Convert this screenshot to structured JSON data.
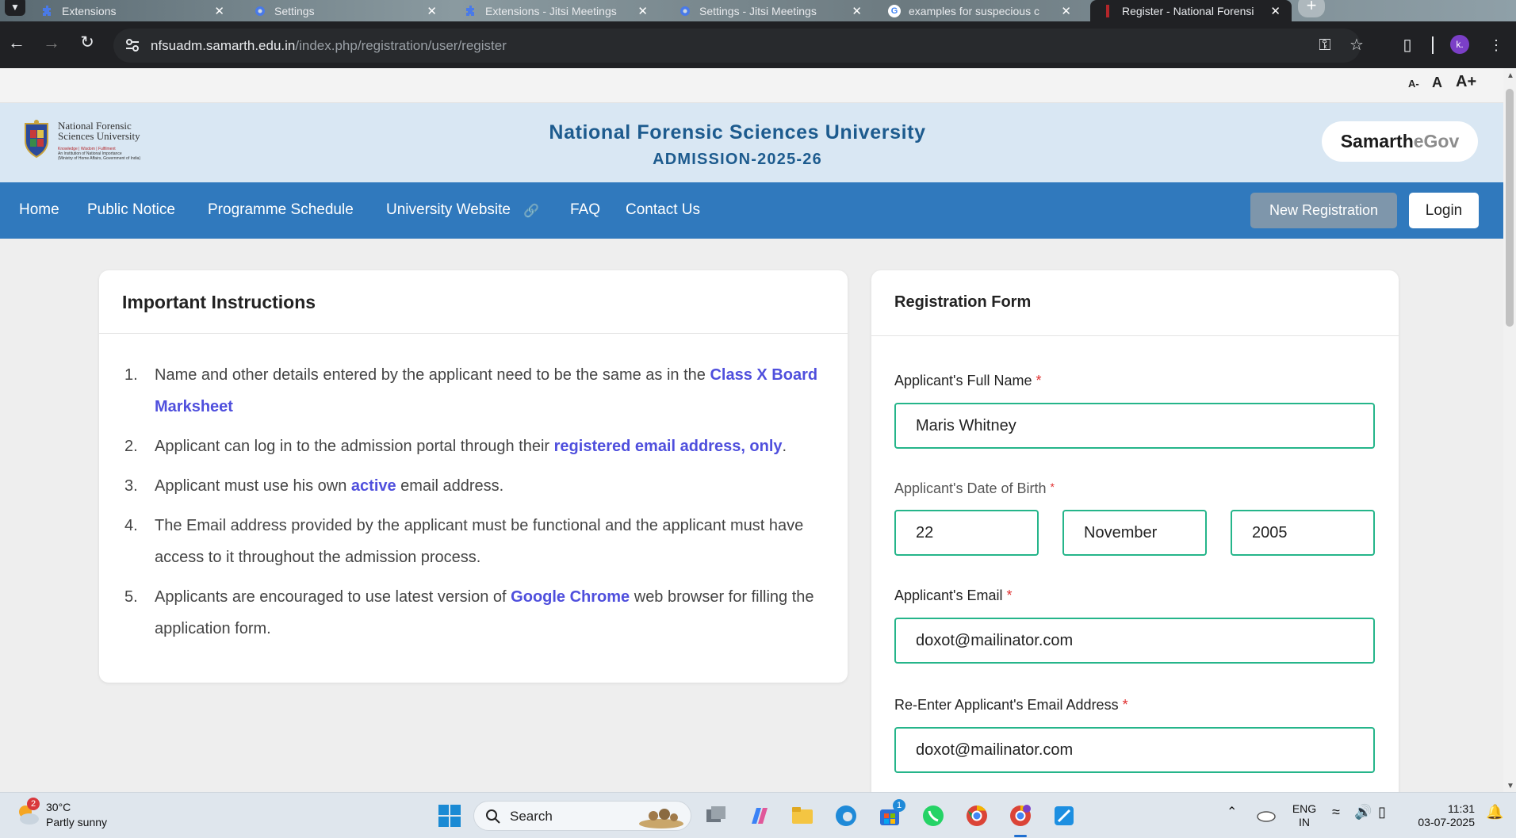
{
  "browser": {
    "tabs": [
      {
        "title": "Extensions",
        "icon": "puzzle-icon"
      },
      {
        "title": "Settings",
        "icon": "gear-icon"
      },
      {
        "title": "Extensions - Jitsi Meetings",
        "icon": "puzzle-icon"
      },
      {
        "title": "Settings - Jitsi Meetings",
        "icon": "gear-icon"
      },
      {
        "title": "examples for suspecious c",
        "icon": "google-icon"
      },
      {
        "title": "Register - National Forensi",
        "icon": "site-icon"
      }
    ],
    "url_host": "nfsuadm.samarth.edu.in",
    "url_path": "/index.php/registration/user/register",
    "profile_initial": "k."
  },
  "font_controls": [
    "A-",
    "A",
    "A+"
  ],
  "header": {
    "logo_line1": "National Forensic",
    "logo_line2": "Sciences University",
    "logo_tagline": "Knowledge | Wisdom | Fulfilment",
    "logo_sub1": "An Institution of National Importance",
    "logo_sub2": "(Ministry of Home Affairs, Government of India)",
    "university": "National Forensic Sciences University",
    "admission": "ADMISSION-2025-26",
    "egov_a": "Samarth",
    "egov_b": "eGov"
  },
  "nav": {
    "items": [
      "Home",
      "Public Notice",
      "Programme Schedule",
      "University Website",
      "FAQ",
      "Contact Us"
    ],
    "new_registration": "New Registration",
    "login": "Login"
  },
  "instructions": {
    "title": "Important Instructions",
    "items": [
      {
        "n": "1.",
        "a": "Name and other details entered by the applicant need to be the same as in the ",
        "b": "Class X Board Marksheet",
        "c": ""
      },
      {
        "n": "2.",
        "a": "Applicant can log in to the admission portal through their ",
        "b": "registered email address, only",
        "c": "."
      },
      {
        "n": "3.",
        "a": "Applicant must use his own ",
        "b": "active",
        "c": " email address."
      },
      {
        "n": "4.",
        "a": "The Email address provided by the applicant must be functional and the applicant must have access to it throughout the admission process.",
        "b": "",
        "c": ""
      },
      {
        "n": "5.",
        "a": "Applicants are encouraged to use latest version of ",
        "b": "Google Chrome",
        "c": " web browser for filling the application form."
      }
    ]
  },
  "form": {
    "title": "Registration Form",
    "name_label": "Applicant's Full Name",
    "name_value": "Maris Whitney",
    "dob_label": "Applicant's Date of Birth",
    "dob_day": "22",
    "dob_month": "November",
    "dob_year": "2005",
    "email_label": "Applicant's Email",
    "email_value": "doxot@mailinator.com",
    "reemail_label": "Re-Enter Applicant's Email Address",
    "reemail_value": "doxot@mailinator.com",
    "required_mark": "*"
  },
  "taskbar": {
    "weather_badge": "2",
    "temp": "30°C",
    "condition": "Partly sunny",
    "search": "Search",
    "store_badge": "1",
    "lang1": "ENG",
    "lang2": "IN",
    "time": "11:31",
    "date": "03-07-2025"
  },
  "colors": {
    "nav": "#3079bd",
    "header": "#d9e7f3",
    "accent_title": "#1d5b8e",
    "field_border": "#25b58a",
    "highlight": "#4f4fdd"
  }
}
